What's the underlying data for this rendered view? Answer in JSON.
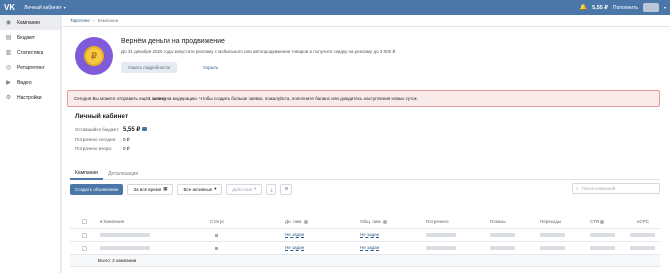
{
  "topbar": {
    "logo": "VK",
    "title": "Личный кабинет",
    "balance": "5,55 ₽",
    "topup": "Пополнить"
  },
  "sidebar": {
    "items": [
      {
        "label": "Кампании",
        "icon": "megaphone-icon",
        "glyph": "◉"
      },
      {
        "label": "Бюджет",
        "icon": "wallet-icon",
        "glyph": "▤"
      },
      {
        "label": "Статистика",
        "icon": "chart-icon",
        "glyph": "▥"
      },
      {
        "label": "Ретаргетинг",
        "icon": "target-icon",
        "glyph": "◎"
      },
      {
        "label": "Видео",
        "icon": "video-icon",
        "glyph": "▶"
      },
      {
        "label": "Настройки",
        "icon": "gear-icon",
        "glyph": "⚙"
      }
    ]
  },
  "breadcrumb": {
    "root": "Таргетинг",
    "current": "Кампании"
  },
  "promo": {
    "title": "Вернём деньги на продвижение",
    "text": "До 31 декабря 2020 года запустите рекламу с мобильного или автопродвижение товаров и получите скидку на рекламу до 3 000 ₽.",
    "more": "Узнать подробности",
    "hide": "Скрыть",
    "coin_symbol": "₽"
  },
  "alert": {
    "before": "Сегодня Вы можете отправить ещё ",
    "bold": "1 заявку",
    "after": " на модерацию. Чтобы создать больше заявок, пожалуйста, пополните баланс или дождитесь наступления новых суток."
  },
  "account": {
    "title": "Личный кабинет",
    "rows": [
      {
        "label": "Оставшийся бюджет:",
        "value": "5,55 ₽"
      },
      {
        "label": "Потрачено сегодня:",
        "value": "0 ₽"
      },
      {
        "label": "Потрачено вчера:",
        "value": "0 ₽"
      }
    ]
  },
  "tabs": [
    "Кампании",
    "Детализация"
  ],
  "toolbar": {
    "create": "Создать объявление",
    "period": "За всё время",
    "filter": "Все активные",
    "actions": "Действия",
    "search_placeholder": "Поиск кампаний"
  },
  "table": {
    "columns": [
      "Кампания",
      "Статус",
      "Дн. лим.",
      "Общ. лим.",
      "Потрачено",
      "Показы",
      "Переходы",
      "CTR",
      "eCPC"
    ],
    "rows": [
      {
        "day_limit": "Не задан",
        "total_limit": "Не задан"
      },
      {
        "day_limit": "Не задан",
        "total_limit": "Не задан"
      }
    ],
    "total": "Всего: 2 кампании"
  }
}
